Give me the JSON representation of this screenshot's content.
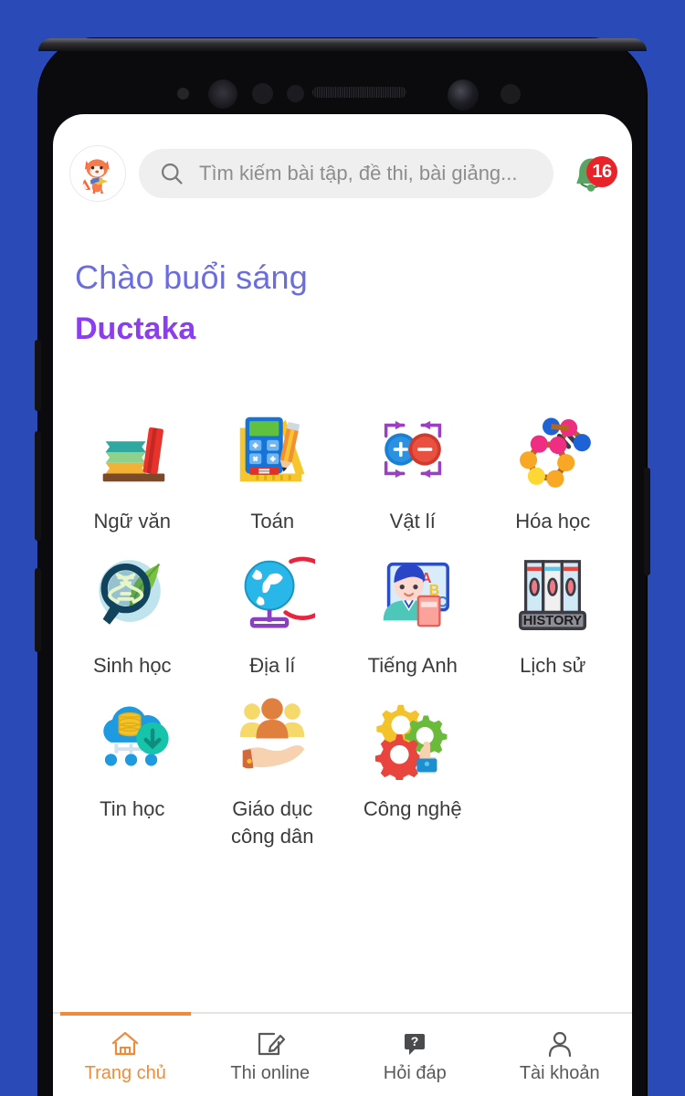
{
  "theme": {
    "background": "#2a4ab8",
    "accent_orange": "#ee8c3c",
    "greeting_color": "#6b6ce0",
    "name_color": "#8b3df0",
    "badge_color": "#e8232a"
  },
  "header": {
    "avatar_icon": "fox-mascot-icon",
    "search": {
      "icon": "search-icon",
      "placeholder": "Tìm kiếm bài tập, đề thi, bài giảng..."
    },
    "notification": {
      "icon": "notification-bell-icon",
      "count": "16"
    }
  },
  "greeting": {
    "hello": "Chào buổi sáng",
    "name": "Ductaka"
  },
  "subjects": [
    {
      "label": "Ngữ văn",
      "icon": "books-stack-icon"
    },
    {
      "label": "Toán",
      "icon": "calculator-ruler-icon"
    },
    {
      "label": "Vật lí",
      "icon": "electric-charges-icon"
    },
    {
      "label": "Hóa học",
      "icon": "molecule-icon"
    },
    {
      "label": "Sinh học",
      "icon": "dna-magnifier-leaf-icon"
    },
    {
      "label": "Địa lí",
      "icon": "globe-stand-icon"
    },
    {
      "label": "Tiếng Anh",
      "icon": "student-abc-board-icon"
    },
    {
      "label": "Lịch sử",
      "icon": "history-books-icon"
    },
    {
      "label": "Tin học",
      "icon": "cloud-database-icon"
    },
    {
      "label": "Giáo dục công dân",
      "icon": "hand-people-icon"
    },
    {
      "label": "Công nghệ",
      "icon": "gears-hand-icon"
    }
  ],
  "bottom_nav": [
    {
      "label": "Trang chủ",
      "icon": "home-icon",
      "active": true
    },
    {
      "label": "Thi online",
      "icon": "pencil-note-icon",
      "active": false
    },
    {
      "label": "Hỏi đáp",
      "icon": "question-bubble-icon",
      "active": false
    },
    {
      "label": "Tài khoản",
      "icon": "user-account-icon",
      "active": false
    }
  ]
}
